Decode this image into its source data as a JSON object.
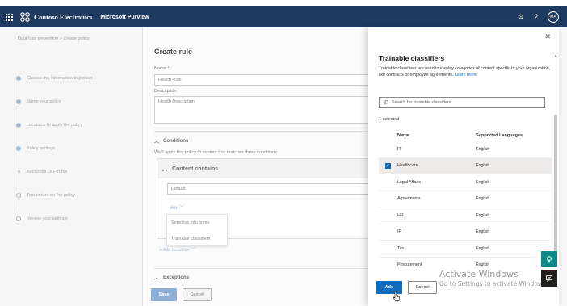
{
  "topbar": {
    "org_name": "Contoso Electronics",
    "product_name": "Microsoft Purview",
    "avatar_initials": "MA",
    "icons": [
      "app-launcher-icon",
      "contoso-logo-icon",
      "settings-icon",
      "help-icon"
    ],
    "background_color": "#1f3a5f"
  },
  "wizard": {
    "breadcrumb": "Data loss prevention  >  Create policy",
    "steps": [
      {
        "label": "Choose the information to protect",
        "state": "done"
      },
      {
        "label": "Name your policy",
        "state": "done"
      },
      {
        "label": "Locations to apply the policy",
        "state": "done"
      },
      {
        "label": "Policy settings",
        "state": "current"
      },
      {
        "label": "Advanced DLP rules",
        "state": "substep"
      },
      {
        "label": "Test or turn on the policy",
        "state": "todo"
      },
      {
        "label": "Review your settings",
        "state": "todo"
      }
    ]
  },
  "rule_panel": {
    "title": "Create rule",
    "name_label": "Name *",
    "name_value": "Health Rule",
    "description_label": "Description",
    "description_value": "Health Description",
    "conditions_header": "Conditions",
    "conditions_desc": "We'll apply this policy to content that matches these conditions.",
    "content_contains": "Content contains",
    "default_value": "Default",
    "add_label": "Add",
    "add_menu": [
      "Sensitive info types",
      "Trainable classifiers"
    ],
    "add_condition": "Add condition",
    "exceptions_header": "Exceptions",
    "save_label": "Save",
    "cancel_label": "Cancel"
  },
  "classifier_panel": {
    "title": "Trainable classifiers",
    "description": "Trainable classifiers are used to identify categories of content specific to your organization, like contracts or employee agreements.",
    "learn_more": "Learn more",
    "search_placeholder": "Search for trainable classifiers",
    "selected_count": "1 selected",
    "columns": {
      "name": "Name",
      "languages": "Supported Languages"
    },
    "rows": [
      {
        "name": "IT",
        "lang": "English",
        "selected": false
      },
      {
        "name": "Healthcare",
        "lang": "English",
        "selected": true
      },
      {
        "name": "Legal Affairs",
        "lang": "English",
        "selected": false
      },
      {
        "name": "Agreements",
        "lang": "English",
        "selected": false
      },
      {
        "name": "HR",
        "lang": "English",
        "selected": false
      },
      {
        "name": "IP",
        "lang": "English",
        "selected": false
      },
      {
        "name": "Tax",
        "lang": "English",
        "selected": false
      },
      {
        "name": "Procurement",
        "lang": "English",
        "selected": false
      }
    ],
    "add_label": "Add",
    "cancel_label": "Cancel",
    "accent_color": "#0f6cbd"
  },
  "watermark": {
    "line1": "Activate Windows",
    "line2": "Go to Settings to activate Windows."
  }
}
